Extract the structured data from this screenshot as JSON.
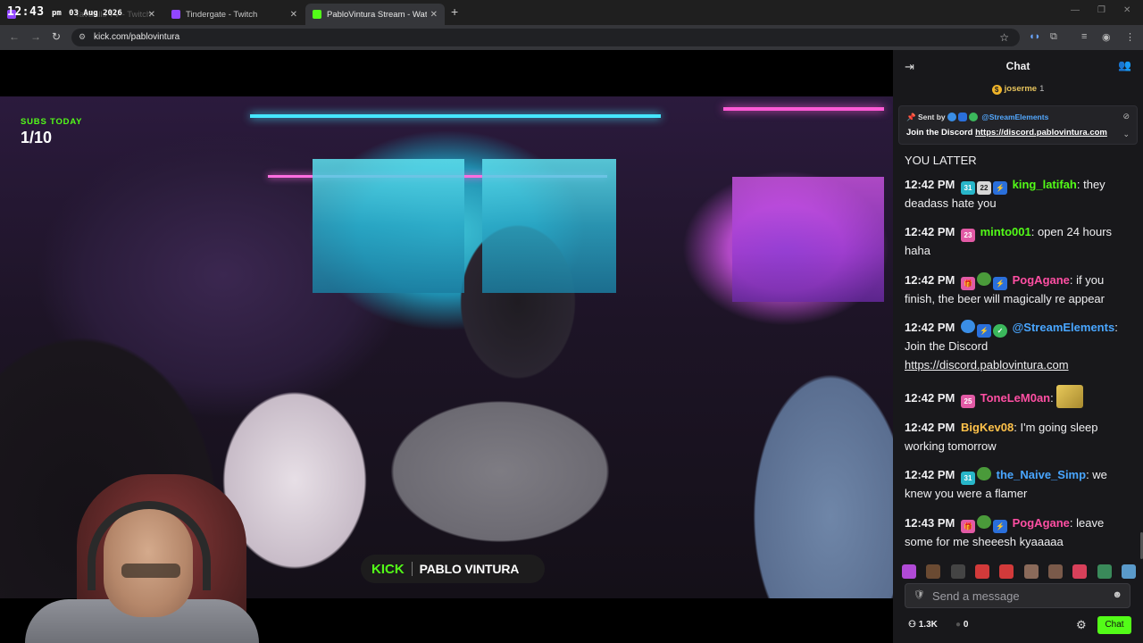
{
  "browser": {
    "clock": {
      "time": "12:43",
      "ampm": "pm",
      "date": "03 Aug 2026"
    },
    "tabs": [
      {
        "title": "TavBalls TV - Twitch",
        "favicon_color": "#9146ff",
        "active": false
      },
      {
        "title": "Tindergate - Twitch",
        "favicon_color": "#9146ff",
        "active": false
      },
      {
        "title": "PabloVintura Stream - Watc",
        "favicon_color": "#53fc18",
        "active": true
      }
    ],
    "new_tab": "+",
    "url": "kick.com/pablovintura"
  },
  "stream": {
    "subs_today_label": "SUBS TODAY",
    "subs_today_value": "1/10",
    "banner_brand": "KICK",
    "banner_name": "PABLO VINTURA"
  },
  "chat": {
    "title": "Chat",
    "top_gifter": {
      "name": "joserme",
      "count": "1"
    },
    "pinned": {
      "sent_by_label": "Sent by",
      "sender": "@StreamElements",
      "text": "Join the Discord",
      "link": "https://discord.pablovintura.com"
    },
    "partial_message": "YOU LATTER",
    "messages": [
      {
        "time": "12:42 PM",
        "badges": [
          "sub:31",
          "og:22",
          "mod"
        ],
        "user": "king_latifah",
        "user_color": "green",
        "text": "they deadass hate you"
      },
      {
        "time": "12:42 PM",
        "badges": [
          "gift:23"
        ],
        "user": "minto001",
        "user_color": "green",
        "text": "open 24 hours haha"
      },
      {
        "time": "12:42 PM",
        "badges": [
          "gift",
          "frog",
          "mod"
        ],
        "user": "PogAgane",
        "user_color": "pink",
        "text": "if you finish, the beer will magically re appear"
      },
      {
        "time": "12:42 PM",
        "badges": [
          "bot",
          "mod",
          "verified"
        ],
        "user": "@StreamElements",
        "user_color": "blue",
        "text": "Join the Discord",
        "link": "https://discord.pablovintura.com"
      },
      {
        "time": "12:42 PM",
        "badges": [
          "gift:25"
        ],
        "user": "ToneLeM0an",
        "user_color": "pink",
        "text": "",
        "emote": true
      },
      {
        "time": "12:42 PM",
        "badges": [],
        "user": "BigKev08",
        "user_color": "yellow",
        "text": "I'm going sleep working tomorrow"
      },
      {
        "time": "12:42 PM",
        "badges": [
          "sub:31",
          "frog"
        ],
        "user": "the_Naive_Simp",
        "user_color": "blue",
        "text": "we knew you were a flamer"
      },
      {
        "time": "12:43 PM",
        "badges": [
          "gift",
          "frog",
          "mod"
        ],
        "user": "PogAgane",
        "user_color": "pink",
        "text": "leave some for me sheeesh kyaaaaa"
      }
    ],
    "emote_bar_colors": [
      "#b04ad6",
      "#6a4a32",
      "#444",
      "#d23a3a",
      "#d23a3a",
      "#8a6a5a",
      "#7a5a4a",
      "#d8405a",
      "#3a8a5a",
      "#5a9aca"
    ],
    "input_placeholder": "Send a message",
    "viewers": "1.3K",
    "points": "0",
    "chat_button": "Chat"
  },
  "colors": {
    "kick_green": "#53fc18",
    "chat_bg": "#18181b"
  }
}
